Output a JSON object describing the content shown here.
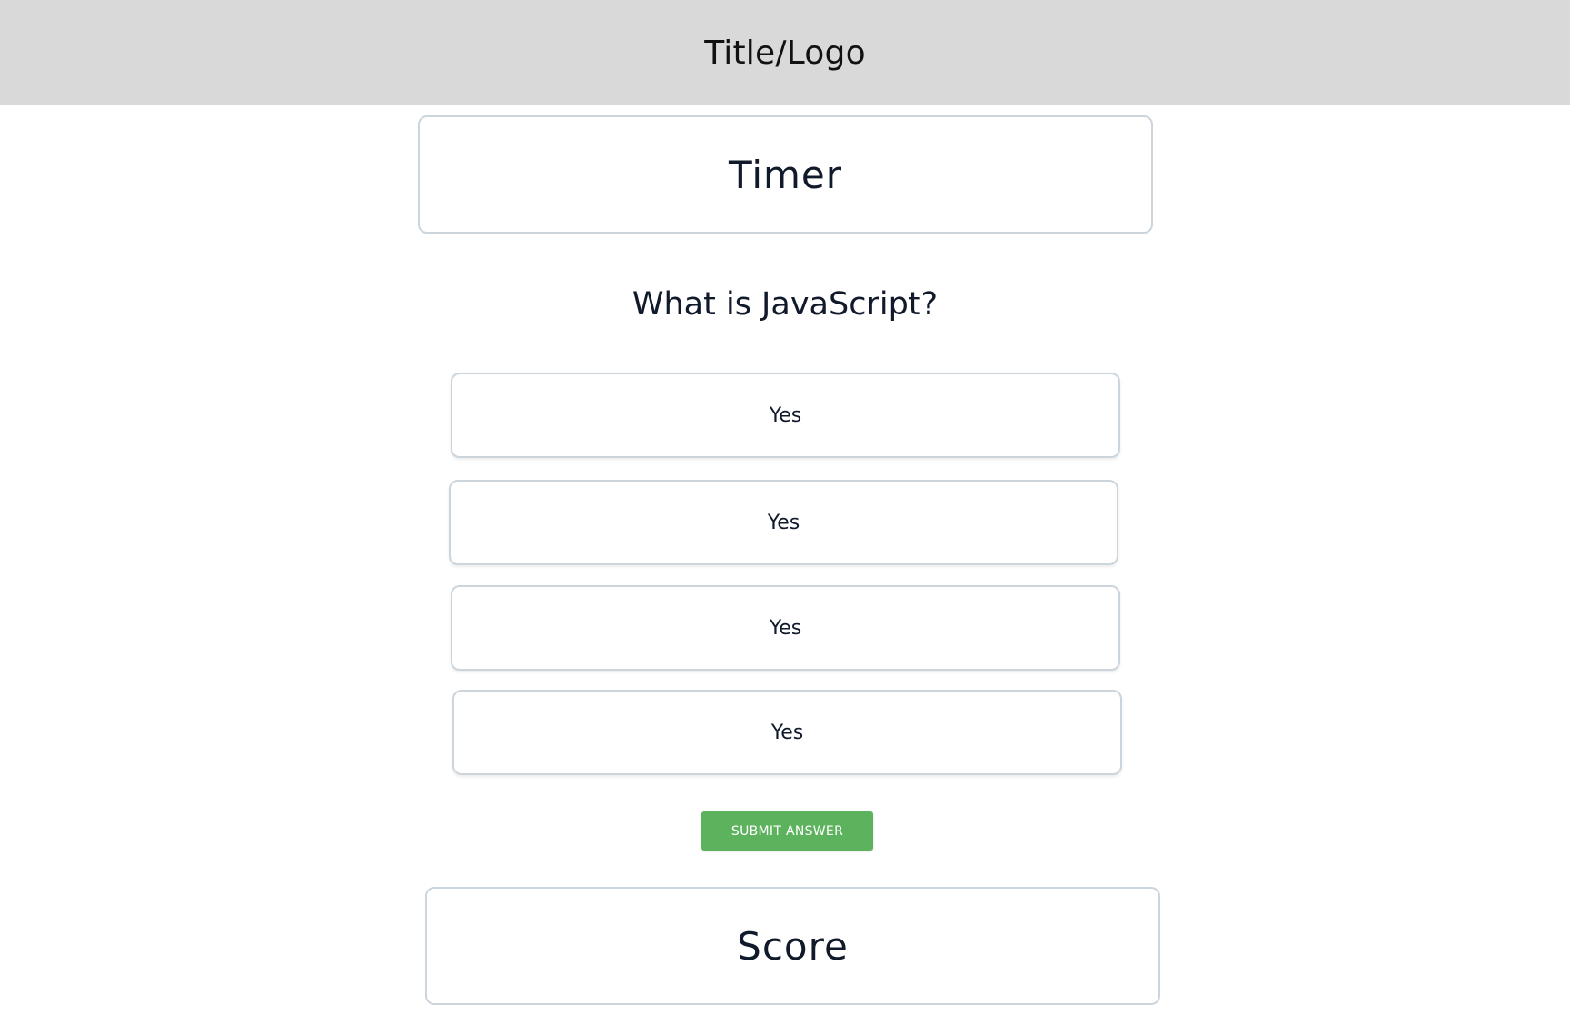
{
  "header": {
    "title": "Title/Logo"
  },
  "timer": {
    "label": "Timer"
  },
  "question": {
    "text": "What is JavaScript?"
  },
  "answers": [
    {
      "label": "Yes"
    },
    {
      "label": "Yes"
    },
    {
      "label": "Yes"
    },
    {
      "label": "Yes"
    }
  ],
  "submit": {
    "label": "SUBMIT ANSWER"
  },
  "score": {
    "label": "Score"
  },
  "colors": {
    "header_bg": "#d9d9d9",
    "submit_bg": "#5cb25d",
    "border": "#cdd5dc",
    "text": "#111a2b"
  }
}
